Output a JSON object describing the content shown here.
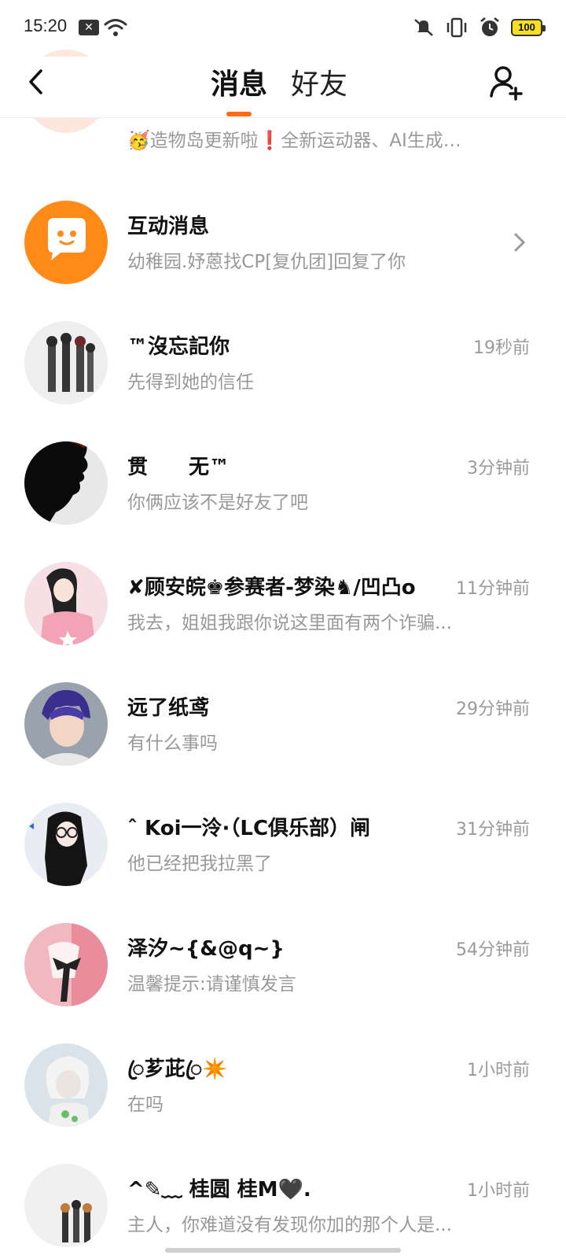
{
  "status_bar": {
    "time": "15:20",
    "notification_icon": "x-box-icon",
    "battery": "100"
  },
  "nav": {
    "tabs": [
      {
        "label": "消息",
        "active": true
      },
      {
        "label": "好友",
        "active": false
      }
    ],
    "accent": "#ff6a14"
  },
  "rows": [
    {
      "title": "",
      "subtitle": "🥳造物岛更新啦❗全新运动器、AI生成场...",
      "time": "",
      "chevron": true
    },
    {
      "title": "互动消息",
      "subtitle": "幼稚园.妤蒽找CP[复仇团]回复了你",
      "time": "",
      "chevron": true
    },
    {
      "title": "™沒忘記你",
      "subtitle": "先得到她的信任",
      "time": "19秒前"
    },
    {
      "title": "贯　　无™",
      "subtitle": "你俩应该不是好友了吧",
      "time": "3分钟前"
    },
    {
      "title": "✘顾安皖♚参赛者-梦染♞/凹凸o",
      "subtitle": "我去，姐姐我跟你说这里面有两个诈骗...",
      "time": "11分钟前"
    },
    {
      "title": "远了纸鸢",
      "subtitle": "有什么事吗",
      "time": "29分钟前"
    },
    {
      "title": "ˆ Koi一泠·（LC俱乐部）闸",
      "subtitle": "他已经把我拉黑了",
      "time": "31分钟前"
    },
    {
      "title": "泽汐~{&@q~}",
      "subtitle": "温馨提示:请谨慎发言",
      "time": "54分钟前"
    },
    {
      "title": "ꦿ芗茈ꦿ✴️",
      "subtitle": "在吗",
      "time": "1小时前"
    },
    {
      "title": "^✎﹏ 桂圆  桂M🖤.",
      "subtitle": "主人，你难道没有发现你加的那个人是...",
      "time": "1小时前"
    }
  ]
}
